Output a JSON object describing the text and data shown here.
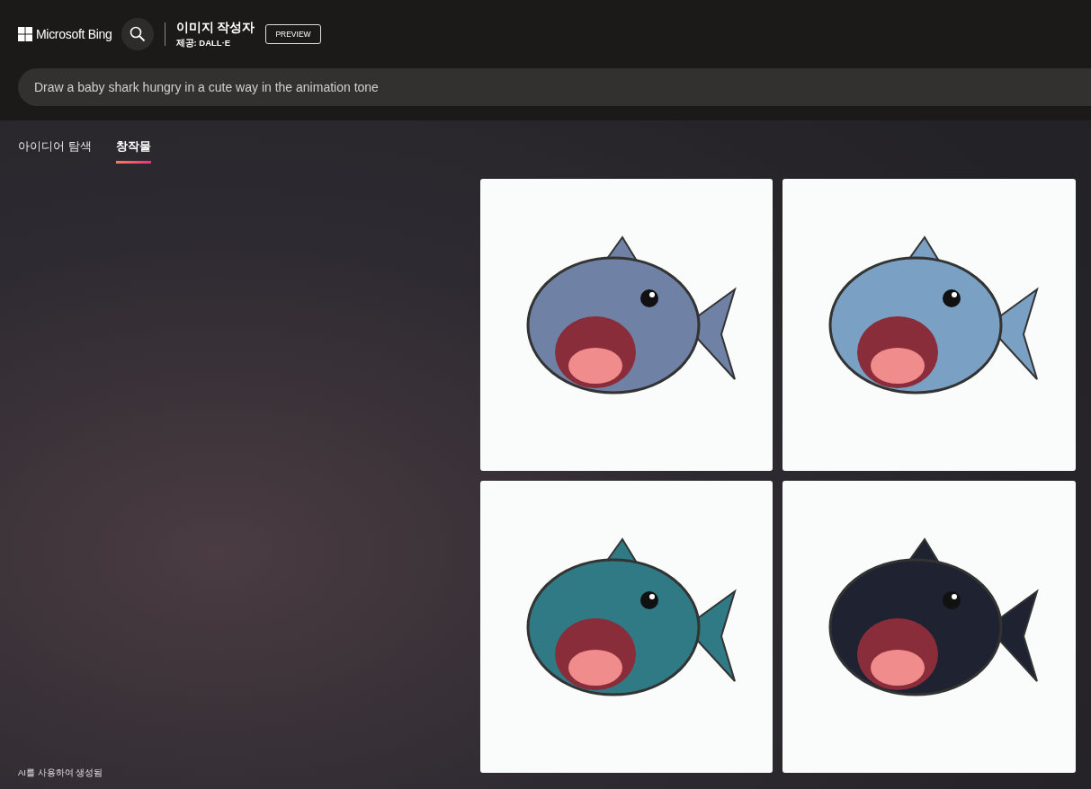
{
  "header": {
    "logo": "Microsoft Bing",
    "title": "이미지 작성자",
    "subtitle": "제공: DALL·E",
    "badge": "PREVIEW"
  },
  "search": {
    "value": "Draw a baby shark hungry in a cute way in the animation tone"
  },
  "tabs": [
    {
      "label": "아이디어 탐색",
      "selected": false
    },
    {
      "label": "창작물",
      "selected": true
    }
  ],
  "images": [
    {
      "kind": "grey"
    },
    {
      "kind": "blue"
    },
    {
      "kind": "teal"
    },
    {
      "kind": "navy"
    }
  ],
  "footer": "AI를 사용하여 생성됨"
}
